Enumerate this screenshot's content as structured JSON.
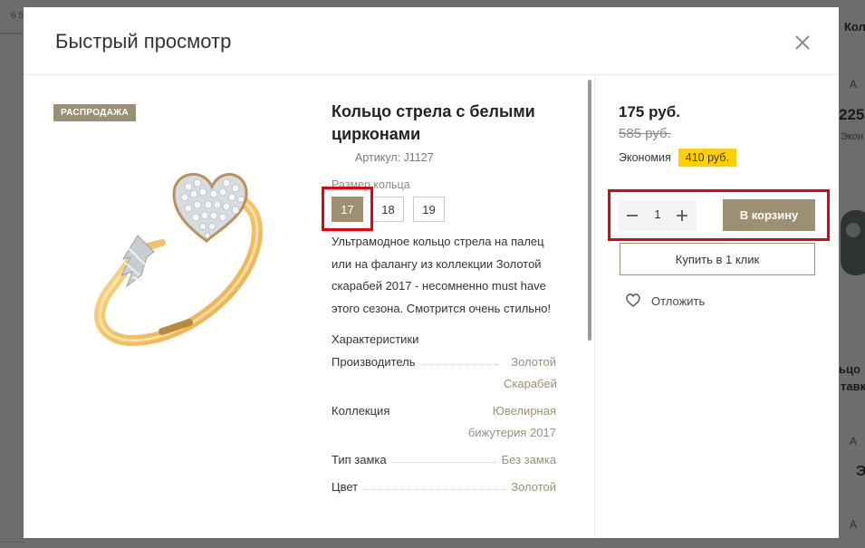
{
  "background": {
    "tl_label": "6 5",
    "right_texts": [
      "Кольцо с б",
      "А",
      "225",
      "Экон",
      "ьцо",
      "тавк",
      "А",
      "Э",
      "А"
    ]
  },
  "modal": {
    "title": "Быстрый просмотр",
    "close_icon": "close-icon"
  },
  "product": {
    "badge": "РАСПРОДАЖА",
    "title": "Кольцо стрела с белыми цирконами",
    "sku": "Артикул: J1127",
    "size_label": "Размер кольца",
    "sizes": [
      "17",
      "18",
      "19"
    ],
    "selected_size": "17",
    "description": "Ультрамодное кольцо стрела на палец или на фалангу из коллекции Золотой скарабей 2017 - несомненно must have этого сезона. Смотрится очень стильно!",
    "specs_title": "Характеристики",
    "specs": [
      {
        "name": "Производитель",
        "value": "Золотой Скарабей"
      },
      {
        "name": "Коллекция",
        "value": "Ювелирная бижутерия 2017"
      },
      {
        "name": "Тип замка",
        "value": "Без замка"
      },
      {
        "name": "Цвет",
        "value": "Золотой"
      }
    ]
  },
  "purchase": {
    "price": "175 руб.",
    "old_price": "585 руб.",
    "savings_label": "Экономия",
    "savings_value": "410 руб.",
    "quantity": "1",
    "add_to_cart": "В корзину",
    "one_click": "Купить в 1 клик",
    "wishlist": "Отложить"
  },
  "colors": {
    "accent": "#9c8f72",
    "badge_yellow": "#ffd000",
    "highlight_red": "#e8000d"
  }
}
